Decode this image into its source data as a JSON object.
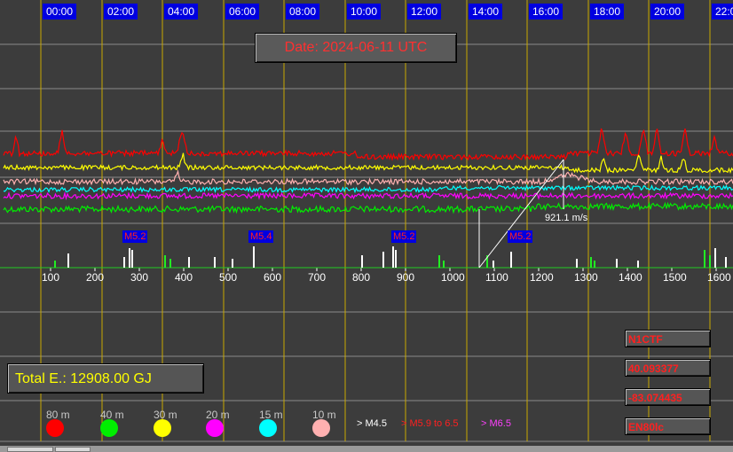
{
  "date_label": "Date: 2024-06-11 UTC",
  "time_labels": [
    "00:00",
    "02:00",
    "04:00",
    "06:00",
    "08:00",
    "10:00",
    "12:00",
    "14:00",
    "16:00",
    "18:00",
    "20:00",
    "22:0"
  ],
  "x_ticks": [
    "100",
    "200",
    "300",
    "400",
    "500",
    "600",
    "700",
    "800",
    "900",
    "1000",
    "1100",
    "1200",
    "1300",
    "1400",
    "1500",
    "1600"
  ],
  "earthquakes": [
    {
      "label": "M5.2"
    },
    {
      "label": "M5.4"
    },
    {
      "label": "M5.2"
    },
    {
      "label": "M5.2"
    }
  ],
  "speed_label": "921.1 m/s",
  "total_energy": "Total E.: 12908.00 GJ",
  "station": {
    "callsign": "N1CTF",
    "lat": "40.093377",
    "lon": "-83.074435",
    "grid": "EN80lc"
  },
  "legend": [
    {
      "label": "80 m",
      "color": "#ff0000"
    },
    {
      "label": "40 m",
      "color": "#00ee00"
    },
    {
      "label": "30 m",
      "color": "#ffff00"
    },
    {
      "label": "20 m",
      "color": "#ff00ff"
    },
    {
      "label": "15 m",
      "color": "#00ffff"
    },
    {
      "label": "10 m",
      "color": "#ffb0b0"
    }
  ],
  "magnitude_legend": [
    {
      "label": "> M4.5",
      "color": "#ffffff"
    },
    {
      "label": "> M5.9 to 6.5",
      "color": "#ff2020"
    },
    {
      "label": "> M6.5",
      "color": "#ff40ff"
    }
  ]
}
